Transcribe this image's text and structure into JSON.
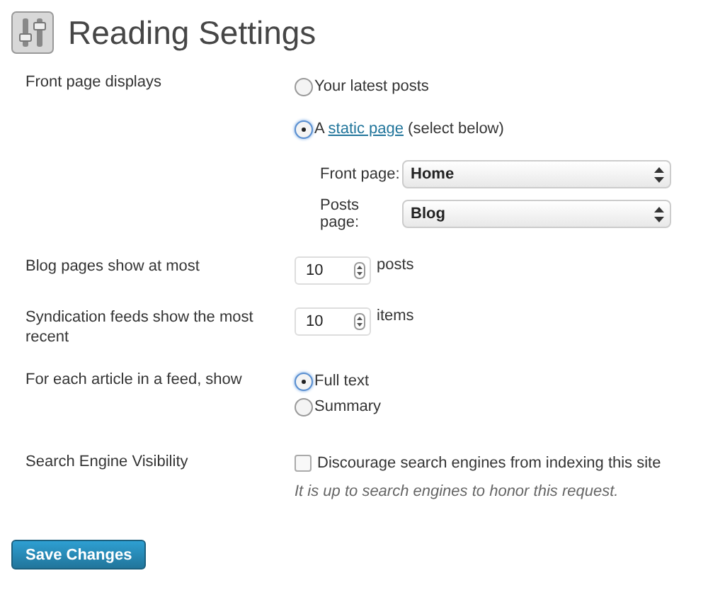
{
  "title": "Reading Settings",
  "front_page": {
    "label": "Front page displays",
    "options": [
      {
        "kind": "plain",
        "text": "Your latest posts",
        "selected": false
      },
      {
        "kind": "link",
        "prefix": "A ",
        "link": "static page",
        "suffix": " (select below)",
        "selected": true
      }
    ],
    "selects": [
      {
        "label": "Front page:",
        "value": "Home"
      },
      {
        "label": "Posts page:",
        "value": "Blog"
      }
    ]
  },
  "numbers": [
    {
      "label": "Blog pages show at most",
      "value": "10",
      "unit": "posts"
    },
    {
      "label": "Syndication feeds show the most recent",
      "value": "10",
      "unit": "items"
    }
  ],
  "feed": {
    "label": "For each article in a feed, show",
    "options": [
      {
        "text": "Full text",
        "selected": true
      },
      {
        "text": "Summary",
        "selected": false
      }
    ]
  },
  "visibility": {
    "label": "Search Engine Visibility",
    "checkbox": "Discourage search engines from indexing this site",
    "checked": false,
    "note": "It is up to search engines to honor this request."
  },
  "save_button": "Save Changes"
}
